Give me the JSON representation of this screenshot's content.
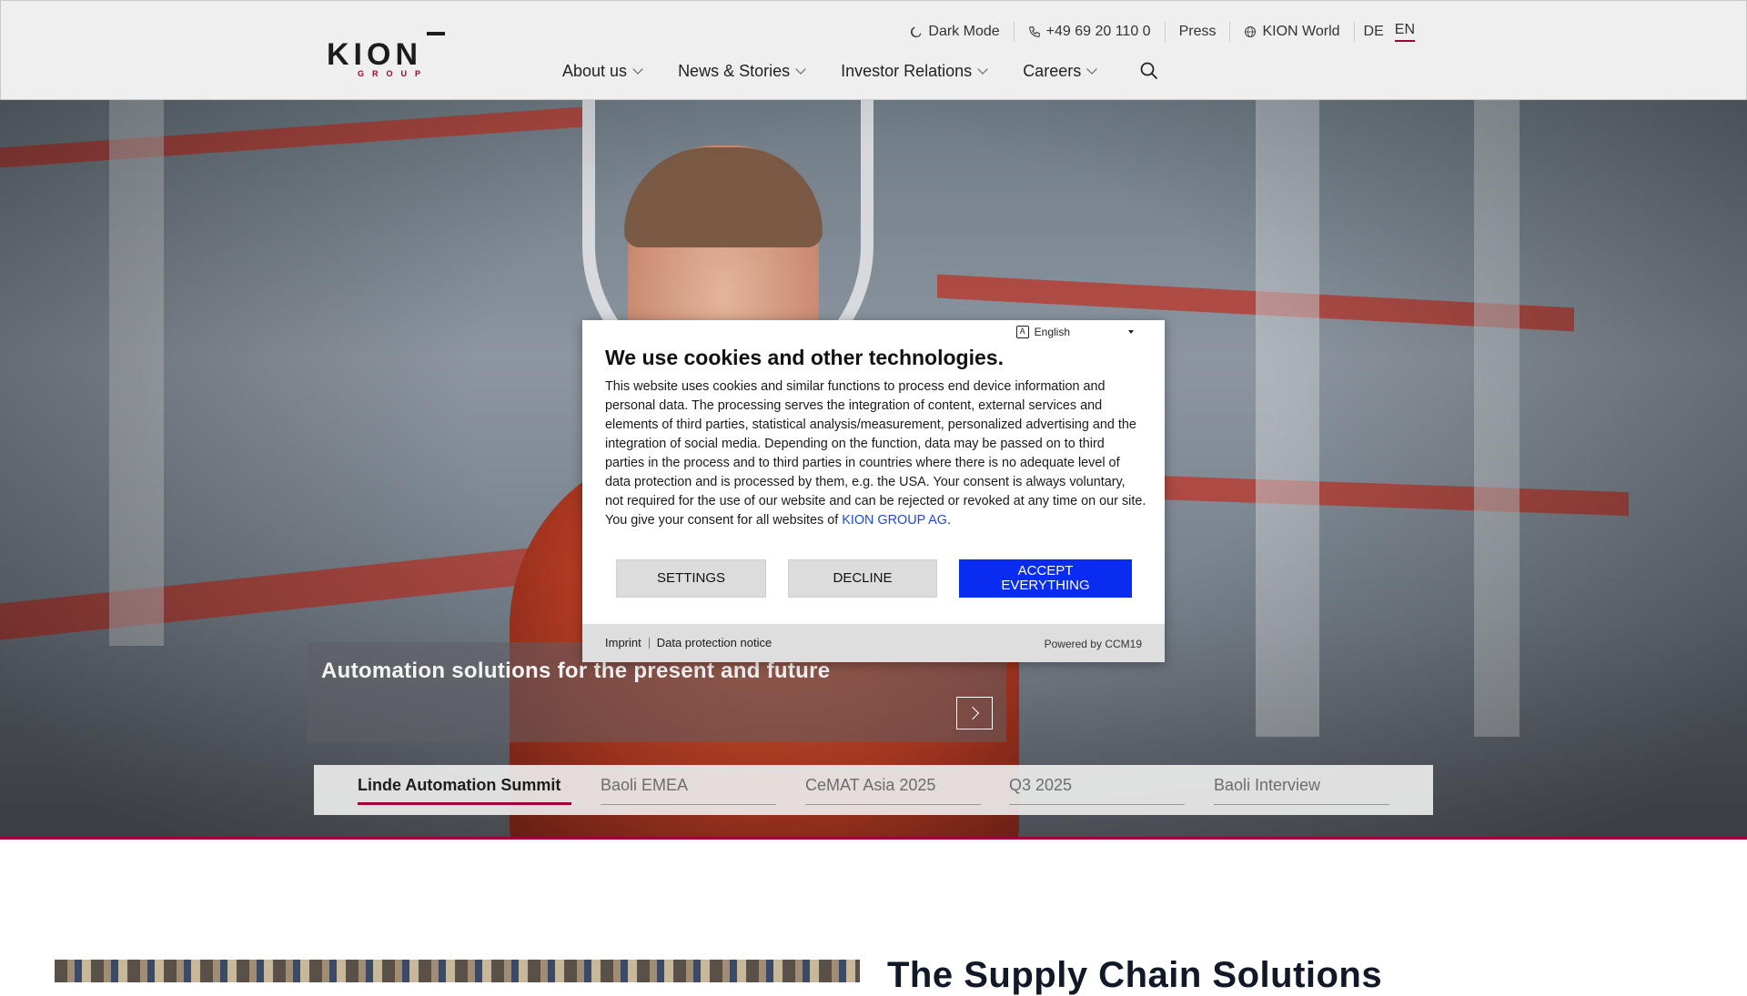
{
  "header": {
    "logo": {
      "brand": "KION",
      "sub": "GROUP",
      "brand_color": "#a1003c"
    },
    "utility": {
      "dark_mode": "Dark Mode",
      "phone": "+49 69 20 110 0",
      "press": "Press",
      "world": "KION World",
      "lang_de": "DE",
      "lang_en": "EN",
      "active_lang": "EN"
    },
    "nav": [
      {
        "label": "About us"
      },
      {
        "label": "News & Stories"
      },
      {
        "label": "Investor Relations"
      },
      {
        "label": "Careers"
      }
    ],
    "icons": {
      "dark_mode": "moon-icon",
      "phone": "phone-icon",
      "world": "globe-icon",
      "search": "search-icon"
    }
  },
  "hero": {
    "caption": "Automation solutions for the present and future",
    "tabs": [
      {
        "label": "Linde Automation Summit",
        "active": true
      },
      {
        "label": "Baoli EMEA",
        "active": false
      },
      {
        "label": "CeMAT Asia 2025",
        "active": false
      },
      {
        "label": "Q3 2025",
        "active": false
      },
      {
        "label": "Baoli Interview",
        "active": false
      }
    ]
  },
  "section": {
    "title": "The Supply Chain Solutions"
  },
  "cookie": {
    "language": "English",
    "title": "We use cookies and other technologies.",
    "body_text": "This website uses cookies and similar functions to process end device information and personal data. The processing serves the integration of content, external services and elements of third parties, statistical analysis/measurement, personalized advertising and the integration of social media. Depending on the function, data may be passed on to third parties in the process and to third parties in countries where there is no adequate level of data protection and is processed by them, e.g. the USA. Your consent is always voluntary, not required for the use of our website and can be rejected or revoked at any time on our site. You give your consent for all websites of ",
    "company_link": "KION GROUP AG",
    "body_end": ".",
    "buttons": {
      "settings": "SETTINGS",
      "decline": "DECLINE",
      "accept": "ACCEPT EVERYTHING"
    },
    "footer": {
      "imprint": "Imprint",
      "privacy": "Data protection notice",
      "powered": "Powered by CCM19"
    },
    "accent_color": "#0a2cf0"
  }
}
